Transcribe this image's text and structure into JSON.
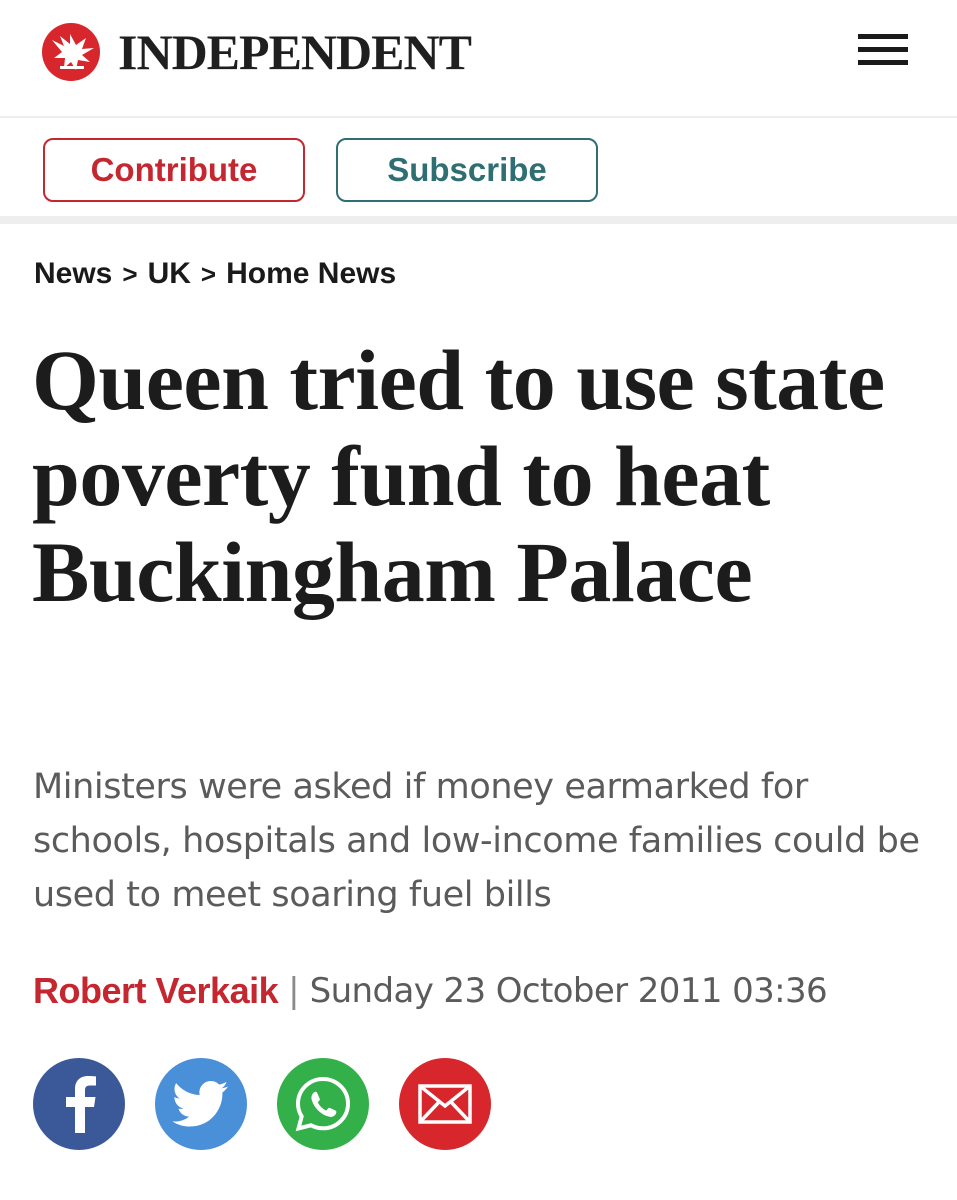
{
  "header": {
    "logo_text": "INDEPENDENT",
    "logo_icon": "eagle-icon",
    "menu_icon": "hamburger-menu-icon"
  },
  "actions": {
    "contribute_label": "Contribute",
    "subscribe_label": "Subscribe"
  },
  "breadcrumb": {
    "items": [
      "News",
      "UK",
      "Home News"
    ],
    "separator": ">"
  },
  "article": {
    "headline": "Queen tried to use state poverty fund to heat Buckingham Palace",
    "standfirst": "Ministers were asked if money earmarked for schools, hospitals and low-income families could be used to meet soaring fuel bills",
    "author": "Robert Verkaik",
    "separator": "|",
    "date": "Sunday 23 October 2011 03:36"
  },
  "share": [
    {
      "icon": "facebook-icon",
      "color": "#3b5998"
    },
    {
      "icon": "twitter-icon",
      "color": "#4a90d9"
    },
    {
      "icon": "whatsapp-icon",
      "color": "#33b04a"
    },
    {
      "icon": "email-icon",
      "color": "#d7262c"
    }
  ],
  "colors": {
    "brand_red": "#c4272f",
    "subscribe_teal": "#2f6f74",
    "headline": "#1c1c1c",
    "standfirst": "#5b5b5b"
  }
}
